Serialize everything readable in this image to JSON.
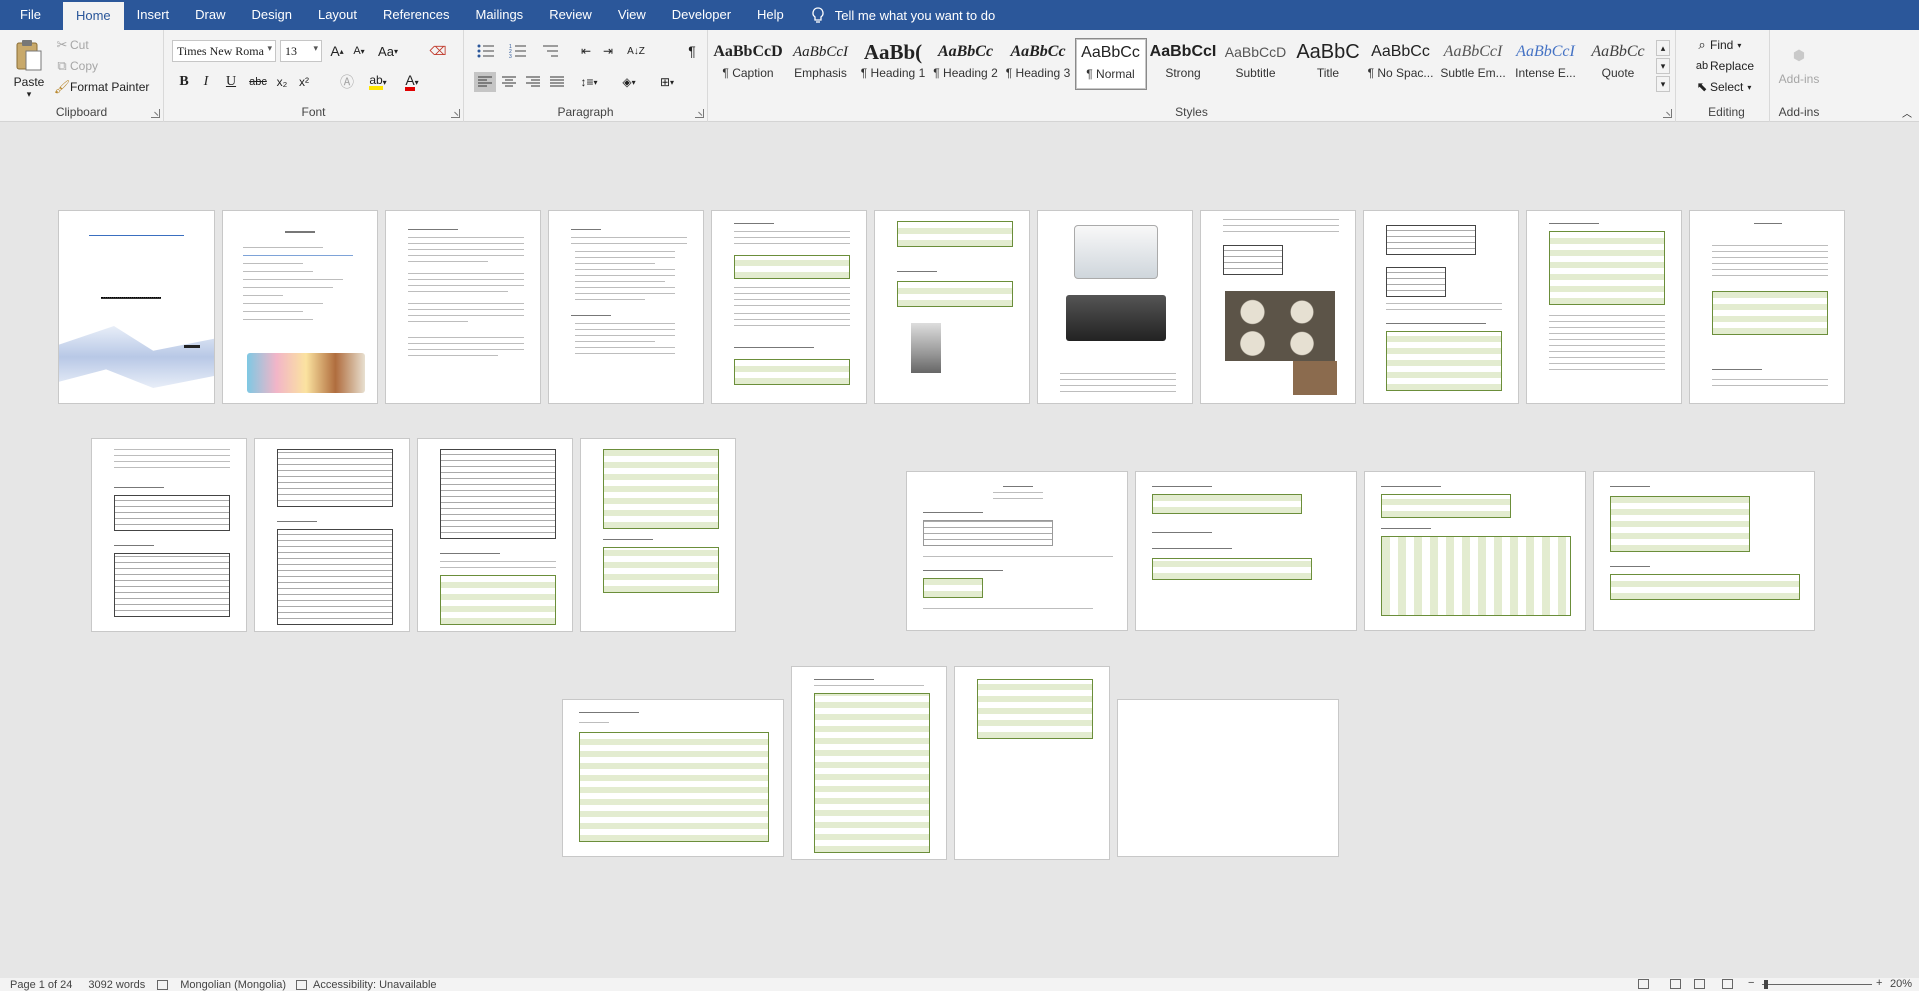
{
  "menu": {
    "tabs": [
      "File",
      "Home",
      "Insert",
      "Draw",
      "Design",
      "Layout",
      "References",
      "Mailings",
      "Review",
      "View",
      "Developer",
      "Help"
    ],
    "active": "Home",
    "tell_me": "Tell me what you want to do"
  },
  "clipboard": {
    "paste": "Paste",
    "cut": "Cut",
    "copy": "Copy",
    "format_painter": "Format Painter",
    "label": "Clipboard"
  },
  "font": {
    "name": "Times New Roma",
    "size": "13",
    "grow": "A",
    "shrink": "A",
    "case": "Aa",
    "bold": "B",
    "italic": "I",
    "underline": "U",
    "strike": "abc",
    "subscript": "x₂",
    "superscript": "x²",
    "label": "Font"
  },
  "paragraph": {
    "label": "Paragraph"
  },
  "styles": {
    "label": "Styles",
    "items": [
      {
        "sample": "AaBbCcD",
        "name": "¶ Caption"
      },
      {
        "sample": "AaBbCcI",
        "name": "Emphasis"
      },
      {
        "sample": "AaBb(",
        "name": "¶ Heading 1"
      },
      {
        "sample": "AaBbCc",
        "name": "¶ Heading 2"
      },
      {
        "sample": "AaBbCc",
        "name": "¶ Heading 3"
      },
      {
        "sample": "AaBbCc",
        "name": "¶ Normal"
      },
      {
        "sample": "AaBbCcI",
        "name": "Strong"
      },
      {
        "sample": "AaBbCcD",
        "name": "Subtitle"
      },
      {
        "sample": "AaBbC",
        "name": "Title"
      },
      {
        "sample": "AaBbCc",
        "name": "¶ No Spac..."
      },
      {
        "sample": "AaBbCcI",
        "name": "Subtle Em..."
      },
      {
        "sample": "AaBbCcI",
        "name": "Intense E..."
      },
      {
        "sample": "AaBbCc",
        "name": "Quote"
      }
    ],
    "selected_index": 5
  },
  "editing": {
    "label": "Editing",
    "find": "Find",
    "replace": "Replace",
    "select": "Select"
  },
  "addins": {
    "label": "Add-ins",
    "button": "Add-ins"
  },
  "status": {
    "page": "Page 1 of 24",
    "words": "3092 words",
    "language": "Mongolian (Mongolia)",
    "accessibility": "Accessibility: Unavailable",
    "zoom": "20%"
  },
  "colors": {
    "ribbon_blue": "#2b579a",
    "ribbon_bg": "#f3f3f3",
    "canvas": "#e6e6e6",
    "table_green": "#e3ecd0"
  }
}
